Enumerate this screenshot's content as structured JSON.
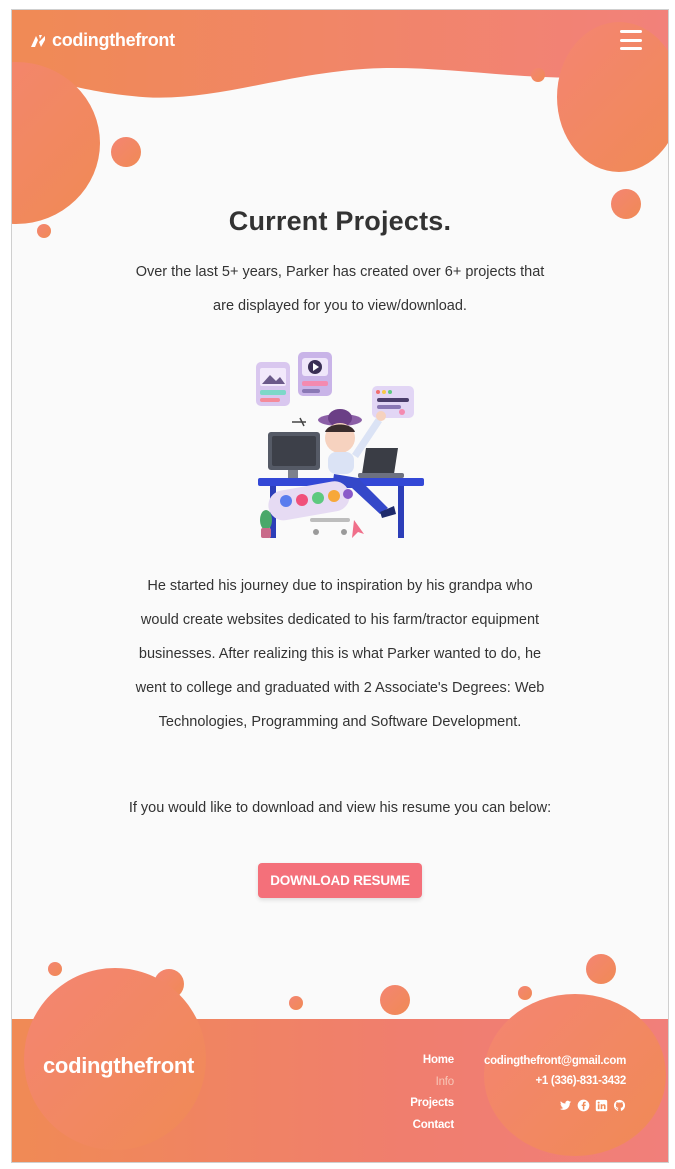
{
  "header": {
    "logo_text": "codingthefront",
    "menu_icon": "hamburger-menu-icon"
  },
  "main": {
    "title": "Current Projects.",
    "intro": "Over the last 5+ years, Parker has created over 6+ projects that are displayed for you to view/download.",
    "illustration": "developer-at-desk-illustration",
    "story": "He started his journey due to inspiration by his grandpa who would create websites dedicated to his farm/tractor equipment businesses. After realizing this is what Parker wanted to do, he went to college and graduated with 2 Associate's Degrees: Web Technologies, Programming and Software Development.",
    "resume_prompt": "If you would like to download and view his resume you can below:",
    "download_button": "DOWNLOAD RESUME"
  },
  "footer": {
    "logo_text": "codingthefront",
    "nav": [
      {
        "label": "Home",
        "active": false
      },
      {
        "label": "Info",
        "active": true
      },
      {
        "label": "Projects",
        "active": false
      },
      {
        "label": "Contact",
        "active": false
      }
    ],
    "email": "codingthefront@gmail.com",
    "phone": "+1 (336)-831-3432",
    "socials": [
      "twitter-icon",
      "facebook-icon",
      "linkedin-icon",
      "github-icon"
    ]
  },
  "colors": {
    "accent": "#f08a55",
    "accent_pink": "#f4707a",
    "background": "#fafafa",
    "text": "#333333"
  }
}
